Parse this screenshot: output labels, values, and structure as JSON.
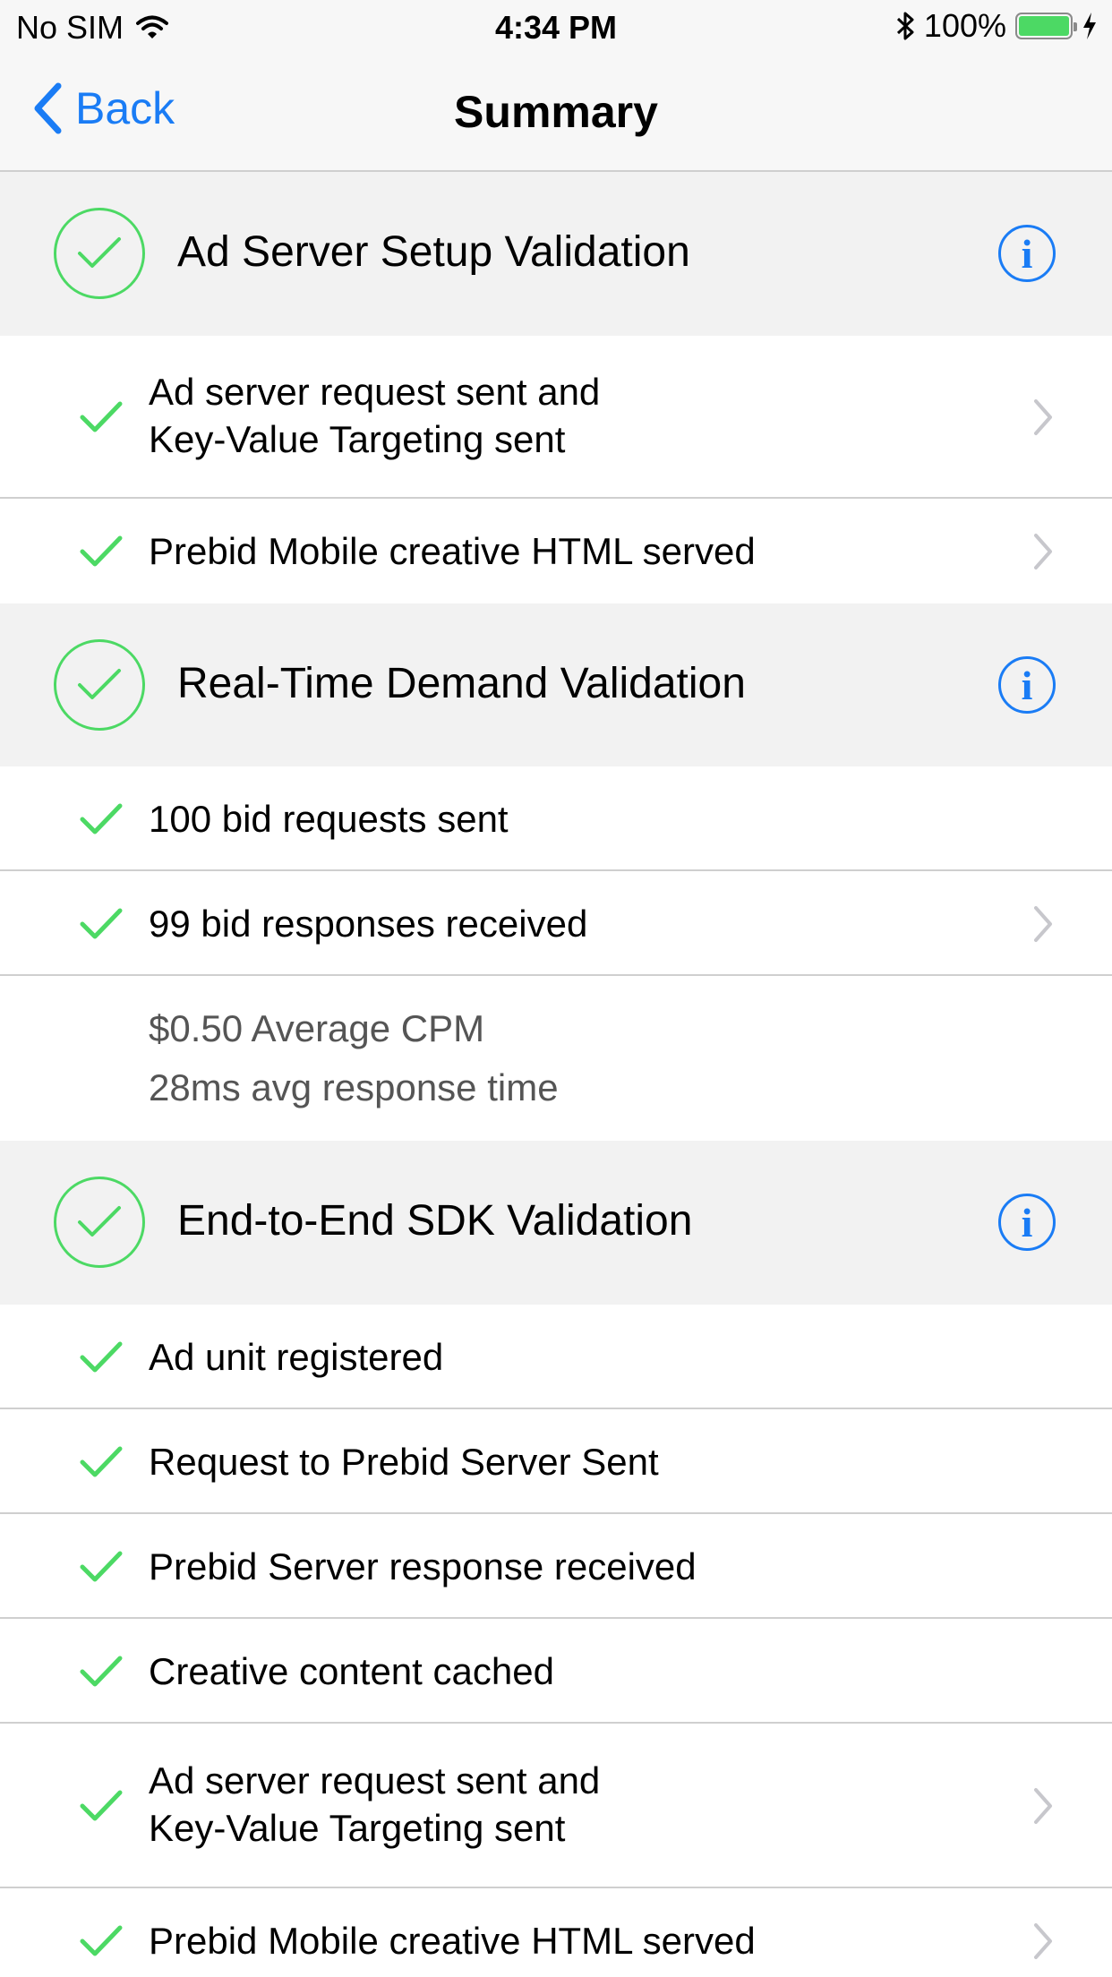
{
  "status_bar": {
    "carrier": "No SIM",
    "time": "4:34 PM",
    "battery": "100%",
    "battery_level": 1.0
  },
  "nav": {
    "back_label": "Back",
    "title": "Summary"
  },
  "sections": [
    {
      "title": "Ad Server Setup Validation",
      "rows": [
        {
          "line1": "Ad server request sent and",
          "line2": "Key-Value Targeting sent",
          "chevron": true
        },
        {
          "line1": "Prebid Mobile creative HTML served",
          "chevron": true
        }
      ]
    },
    {
      "title": "Real-Time Demand Validation",
      "rows": [
        {
          "line1": "100 bid requests sent",
          "chevron": false
        },
        {
          "line1": "99 bid responses received",
          "chevron": true
        }
      ],
      "stats": {
        "average_cpm": "$0.50 Average CPM",
        "avg_response_time": "28ms avg response time"
      }
    },
    {
      "title": "End-to-End SDK Validation",
      "rows": [
        {
          "line1": "Ad unit registered",
          "chevron": false
        },
        {
          "line1": "Request to Prebid Server Sent",
          "chevron": false
        },
        {
          "line1": "Prebid Server response received",
          "chevron": false
        },
        {
          "line1": "Creative content cached",
          "chevron": false
        },
        {
          "line1": "Ad server request sent and",
          "line2": "Key-Value Targeting sent",
          "chevron": true
        },
        {
          "line1": "Prebid Mobile creative HTML served",
          "chevron": true
        }
      ]
    }
  ],
  "icons": {
    "info": "i"
  },
  "colors": {
    "accent_blue": "#1a7cf5",
    "check_green": "#4cd964",
    "section_bg": "#f2f2f2",
    "separator": "#cfcfcf"
  }
}
